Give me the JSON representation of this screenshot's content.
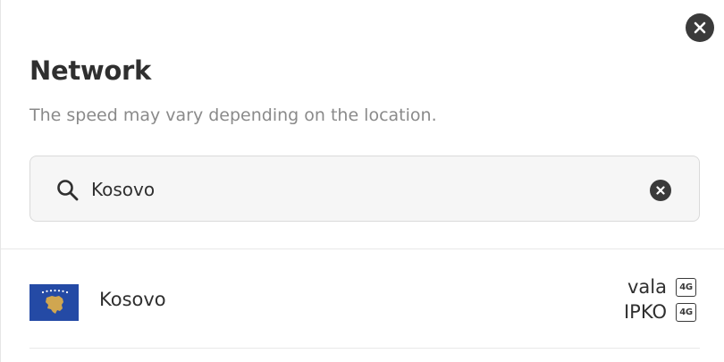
{
  "modal": {
    "title": "Network",
    "subtitle": "The speed may vary depending on the location."
  },
  "search": {
    "value": "Kosovo",
    "icon": "search-icon",
    "clear_icon": "clear-icon"
  },
  "close_icon": "close-icon",
  "results": [
    {
      "country": "Kosovo",
      "flag_icon": "kosovo-flag-icon",
      "carriers": [
        {
          "name": "vala",
          "network": "4G"
        },
        {
          "name": "IPKO",
          "network": "4G"
        }
      ]
    }
  ],
  "colors": {
    "text": "#2f2f2f",
    "subtitle": "#8a8a8a",
    "search_bg": "#f6f6f6",
    "icon_dark": "#3a3a3a",
    "flag_blue": "#244AA5",
    "flag_gold": "#D0A650"
  }
}
